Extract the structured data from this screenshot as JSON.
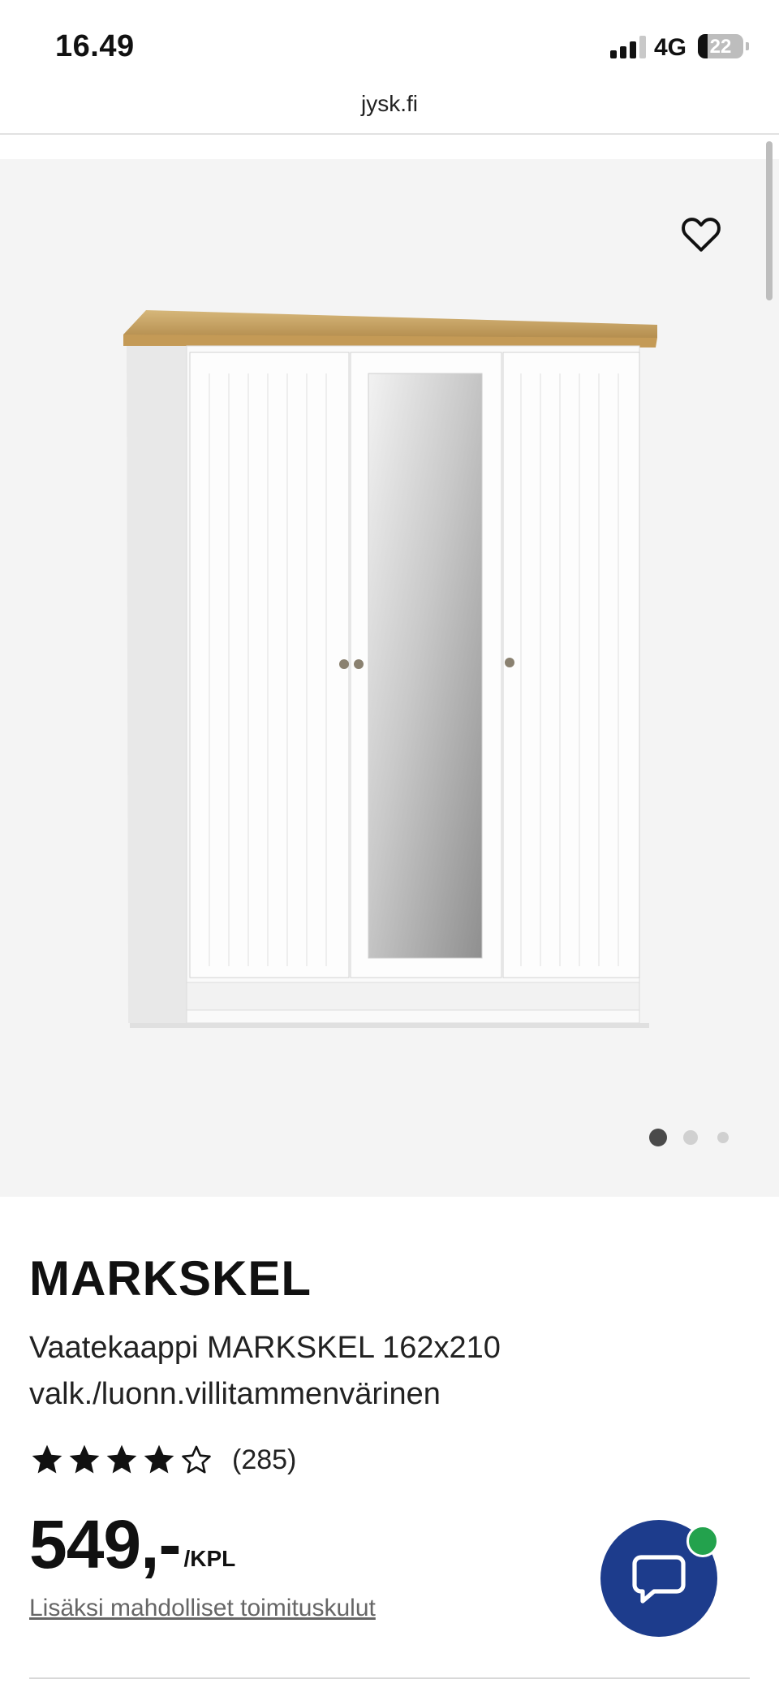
{
  "status_bar": {
    "time": "16.49",
    "network": "4G",
    "battery": "22"
  },
  "browser": {
    "url": "jysk.fi"
  },
  "gallery": {
    "image_alt": "MARKSKEL wardrobe",
    "favorite_icon": "heart-icon",
    "active_slide": 1,
    "slide_count": 3
  },
  "product": {
    "brand": "MARKSKEL",
    "description_line1": "Vaatekaappi MARKSKEL 162x210",
    "description_line2": "valk./luonn.villitammenvärinen",
    "rating": 4,
    "rating_max": 5,
    "review_count": "(285)",
    "price": "549,-",
    "unit": "/KPL",
    "shipping_note": "Lisäksi mahdolliset toimituskulut"
  },
  "chat": {
    "icon": "chat-bubble-icon",
    "status_color": "#23a24d"
  },
  "colors": {
    "chat_button": "#1d3c8c",
    "gallery_bg": "#f4f4f4"
  }
}
